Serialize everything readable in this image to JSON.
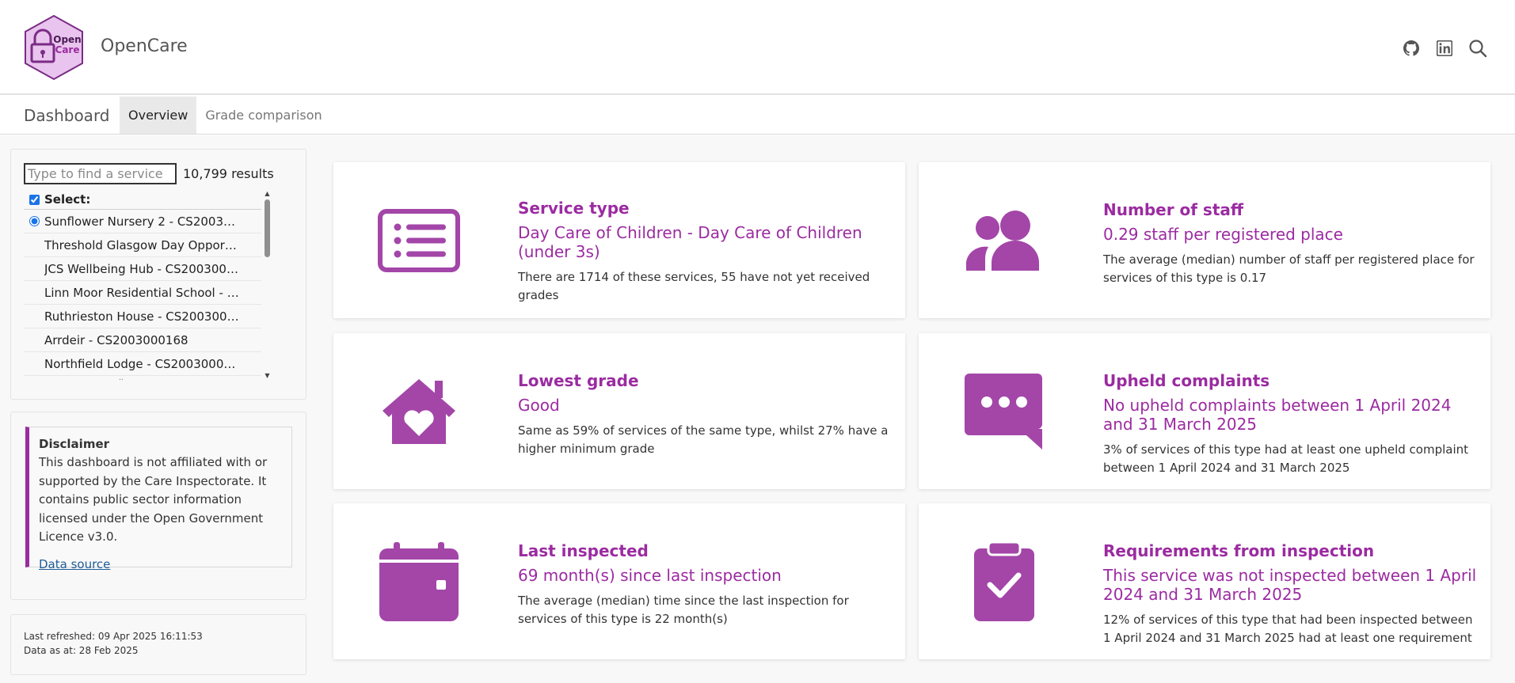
{
  "header": {
    "brand": "OpenCare",
    "logo_text_top": "Open",
    "logo_text_bottom": "Care",
    "icons": [
      "github-icon",
      "linkedin-icon",
      "search-icon"
    ]
  },
  "nav": {
    "title": "Dashboard",
    "tabs": [
      {
        "label": "Overview",
        "active": true
      },
      {
        "label": "Grade comparison",
        "active": false
      }
    ]
  },
  "sidebar": {
    "search_placeholder": "Type to find a service",
    "results": "10,799 results",
    "select_label": "Select:",
    "services": [
      "Sunflower Nursery 2 - CS2003000...",
      "Threshold Glasgow Day Opportu...",
      "JCS Wellbeing Hub - CS20030001...",
      "Linn Moor Residential School - C...",
      "Ruthrieston House - CS20030001...",
      "Arrdeir - CS2003000168",
      "Northfield Lodge - CS2003000170"
    ],
    "disclaimer": {
      "title": "Disclaimer",
      "body": "This dashboard is not affiliated with or supported by the Care Inspectorate. It contains public sector information licensed under the Open Government Licence v3.0.",
      "link": "Data source"
    },
    "last_refreshed": "Last refreshed: 09 Apr 2025 16:11:53",
    "data_as_at": "Data as at: 28 Feb 2025"
  },
  "colors": {
    "accent": "#9b2ba1",
    "icon": "#a346a8",
    "link": "#1d5c97"
  },
  "cards": [
    {
      "icon": "list-icon",
      "title": "Service type",
      "value": "Day Care of Children - Day Care of Children (under 3s)",
      "desc": "There are 1714 of these services, 55 have not yet received grades"
    },
    {
      "icon": "users-icon",
      "title": "Number of staff",
      "value": "0.29 staff per registered place",
      "desc": "The average (median) number of staff per registered place for services of this type is 0.17"
    },
    {
      "icon": "house-heart-icon",
      "title": "Lowest grade",
      "value": "Good",
      "desc": "Same as 59% of services of the same type, whilst 27% have a higher minimum grade"
    },
    {
      "icon": "message-dots-icon",
      "title": "Upheld complaints",
      "value": "No upheld complaints between 1 April 2024 and 31 March 2025",
      "desc": "3% of services of this type had at least one upheld complaint between 1 April 2024 and 31 March 2025"
    },
    {
      "icon": "calendar-icon",
      "title": "Last inspected",
      "value": "69 month(s) since last inspection",
      "desc": "The average (median) time since the last inspection for services of this type is 22 month(s)"
    },
    {
      "icon": "clipboard-check-icon",
      "title": "Requirements from inspection",
      "value": "This service was not inspected between 1 April 2024 and 31 March 2025",
      "desc": "12% of services of this type that had been inspected between 1 April 2024 and 31 March 2025 had at least one requirement"
    }
  ]
}
